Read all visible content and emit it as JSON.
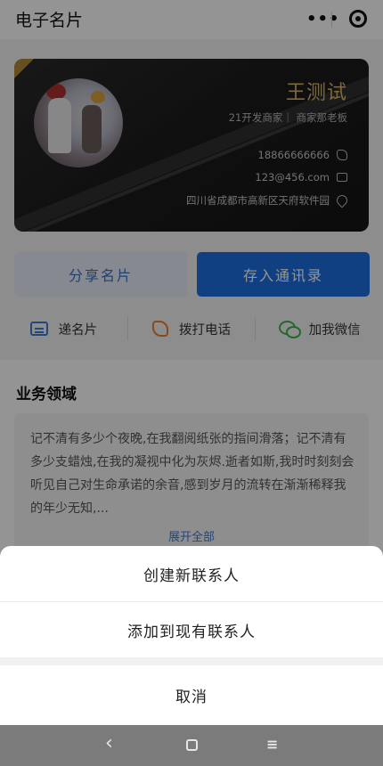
{
  "header": {
    "title": "电子名片",
    "more_icon": "more-dots-icon",
    "close_icon": "target-circle-icon"
  },
  "card": {
    "name": "王测试",
    "role": "21开发商家｜ 商家那老板",
    "phone": "18866666666",
    "email": "123@456.com",
    "address": "四川省成都市高新区天府软件园",
    "accent_color": "#d8b568"
  },
  "buttons": {
    "share": "分享名片",
    "save": "存入通讯录"
  },
  "actions": [
    {
      "label": "递名片",
      "icon": "card-icon"
    },
    {
      "label": "拨打电话",
      "icon": "phone-icon"
    },
    {
      "label": "加我微信",
      "icon": "wechat-icon"
    }
  ],
  "business": {
    "title": "业务领域",
    "description": "记不清有多少个夜晚,在我翻阅纸张的指间滑落；记不清有多少支蜡烛,在我的凝视中化为灰烬.逝者如斯,我时时刻刻会听见自己对生命承诺的余音,感到岁月的流转在渐渐稀释我的年少无知,...",
    "expand": "展开全部"
  },
  "sheet": {
    "option1": "创建新联系人",
    "option2": "添加到现有联系人",
    "cancel": "取消"
  },
  "navbar": {
    "back": "‹",
    "home": "home-square-icon",
    "menu": "≡"
  }
}
